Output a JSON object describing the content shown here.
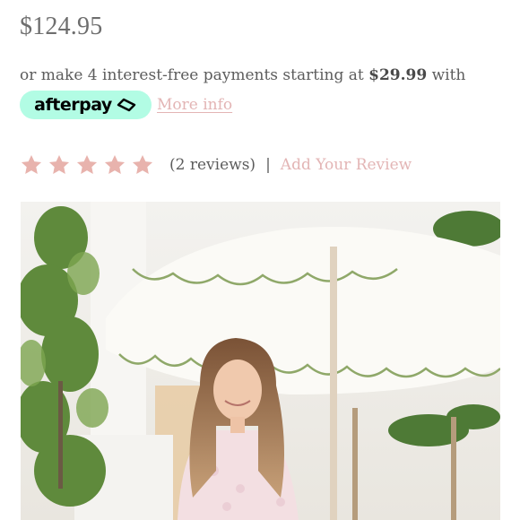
{
  "product": {
    "price": "$124.95"
  },
  "payments": {
    "prefix": "or make 4 interest-free payments starting at",
    "amount": "$29.99",
    "suffix": "with",
    "provider_label": "afterpay",
    "more_info": "More info",
    "badge_color": "#b2fce4"
  },
  "reviews": {
    "rating": 5,
    "max_rating": 5,
    "count_text": "(2 reviews)",
    "separator": "|",
    "add_review": "Add Your Review",
    "star_color": "#e8b3ad"
  },
  "image": {
    "alt": "product-photo"
  }
}
